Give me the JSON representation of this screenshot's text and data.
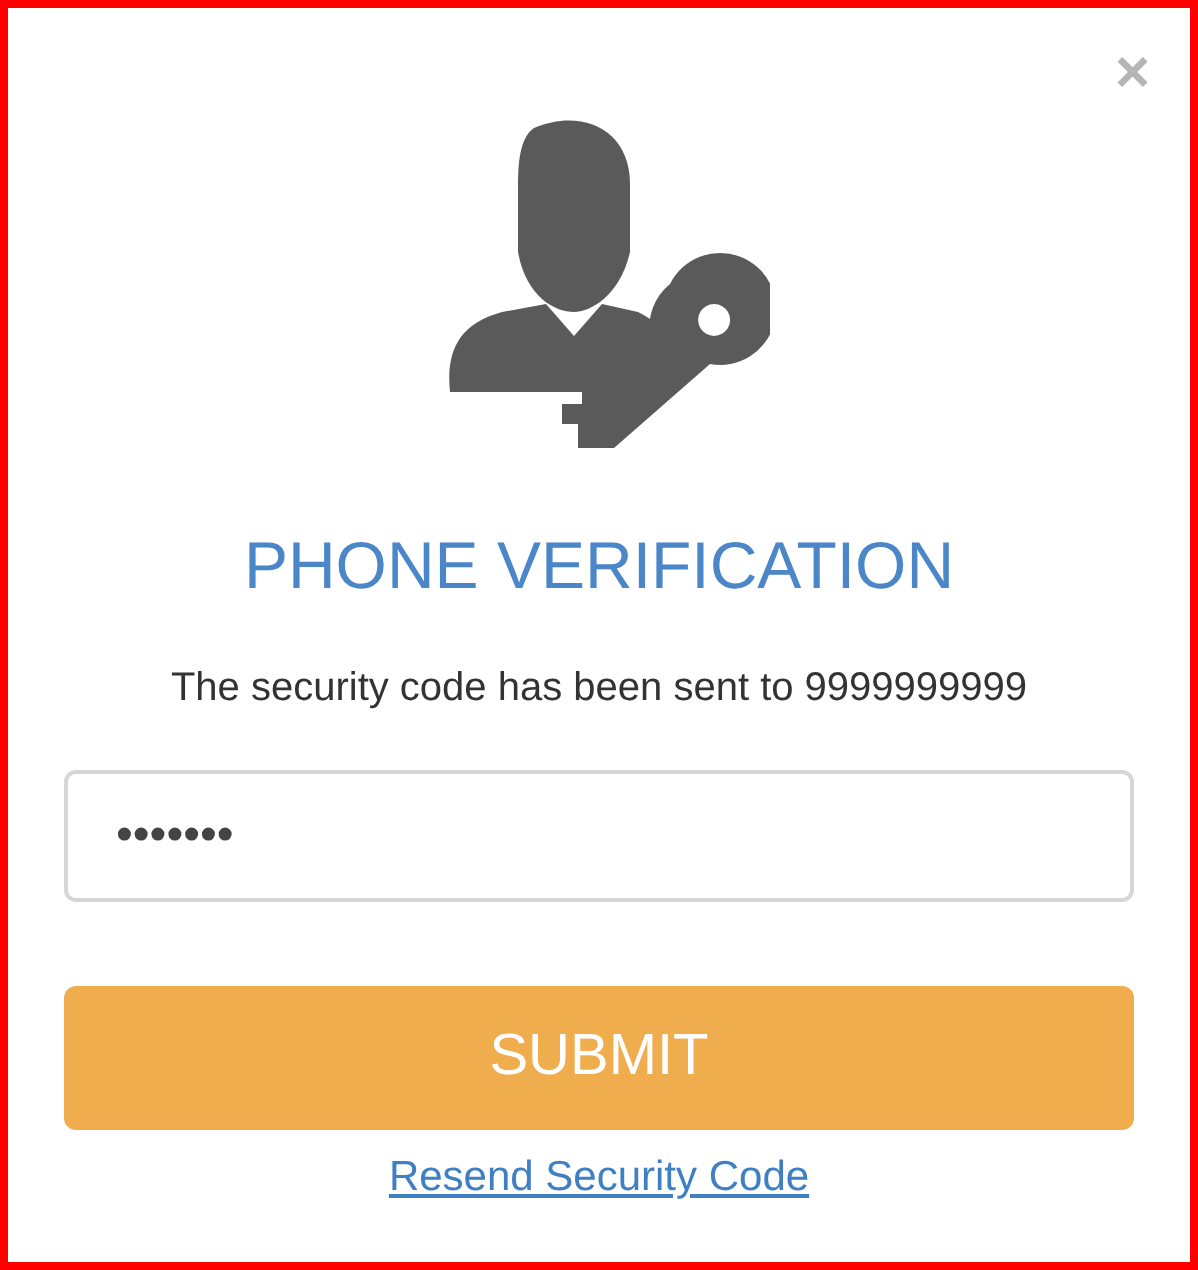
{
  "dialog": {
    "close": "×",
    "title": "PHONE VERIFICATION",
    "message": "The security code has been sent to 9999999999"
  },
  "code_field": {
    "value": "•••••••"
  },
  "submit_button": "SUBMIT",
  "resend_link": "Resend Security Code"
}
